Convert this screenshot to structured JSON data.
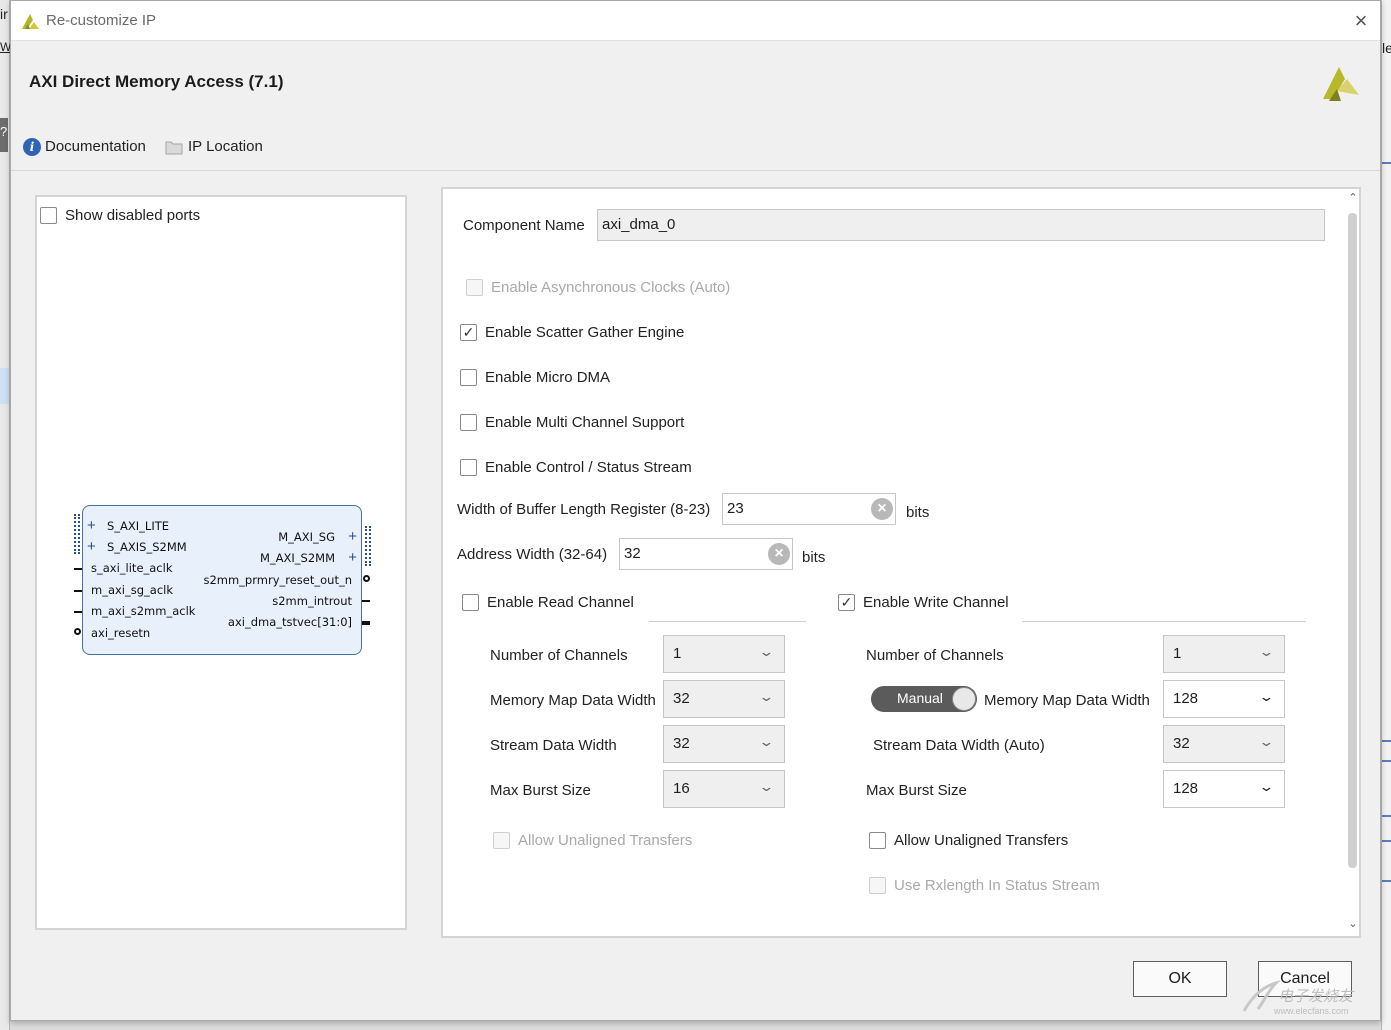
{
  "dialog": {
    "title": "Re-customize IP",
    "close_icon": "×",
    "ip_name": "AXI Direct Memory Access (7.1)"
  },
  "links": {
    "documentation": "Documentation",
    "ip_location": "IP Location"
  },
  "background": {
    "left_fragments": [
      "ir",
      "Wi",
      "?"
    ],
    "right_fragments": [
      "le"
    ]
  },
  "symbol_panel": {
    "show_disabled_ports_label": "Show disabled ports",
    "show_disabled_ports_checked": false,
    "left_ports": [
      "S_AXI_LITE",
      "S_AXIS_S2MM",
      "s_axi_lite_aclk",
      "m_axi_sg_aclk",
      "m_axi_s2mm_aclk",
      "axi_resetn"
    ],
    "right_ports": [
      "M_AXI_SG",
      "M_AXI_S2MM",
      "s2mm_prmry_reset_out_n",
      "s2mm_introut",
      "axi_dma_tstvec[31:0]"
    ]
  },
  "settings": {
    "component_name_label": "Component Name",
    "component_name_value": "axi_dma_0",
    "async_clocks_label": "Enable Asynchronous Clocks (Auto)",
    "scatter_gather_label": "Enable Scatter Gather Engine",
    "scatter_gather_checked": true,
    "micro_dma_label": "Enable Micro DMA",
    "multi_channel_label": "Enable Multi Channel Support",
    "control_status_label": "Enable Control / Status Stream",
    "buffer_length_label": "Width of Buffer Length Register (8-23)",
    "buffer_length_value": "23",
    "buffer_length_unit": "bits",
    "address_width_label": "Address Width (32-64)",
    "address_width_value": "32",
    "address_width_unit": "bits",
    "clear_icon": "×"
  },
  "read_channel": {
    "enable_label": "Enable Read Channel",
    "enabled": false,
    "num_channels_label": "Number of Channels",
    "num_channels": "1",
    "mm_data_width_label": "Memory Map Data Width",
    "mm_data_width": "32",
    "stream_data_width_label": "Stream Data Width",
    "stream_data_width": "32",
    "max_burst_label": "Max Burst Size",
    "max_burst": "16",
    "unaligned_label": "Allow Unaligned Transfers"
  },
  "write_channel": {
    "enable_label": "Enable Write Channel",
    "enabled": true,
    "num_channels_label": "Number of Channels",
    "num_channels": "1",
    "manual_toggle_label": "Manual",
    "mm_data_width_label": "Memory Map Data Width",
    "mm_data_width": "128",
    "stream_data_width_label": "Stream Data Width (Auto)",
    "stream_data_width": "32",
    "max_burst_label": "Max Burst Size",
    "max_burst": "128",
    "unaligned_label": "Allow Unaligned Transfers",
    "rxlength_label": "Use Rxlength In Status Stream"
  },
  "chevron_icon": "⌄",
  "scroll_up_icon": "⌃",
  "scroll_down_icon": "⌄",
  "footer": {
    "ok_label": "OK",
    "cancel_label": "Cancel"
  },
  "watermark": {
    "line1": "电子发烧友",
    "line2": "www.elecfans.com"
  },
  "colors": {
    "accent": "#4a6fa5",
    "dialog_bg": "#f0f0f0",
    "toggle_bg": "#5b5b5b"
  }
}
